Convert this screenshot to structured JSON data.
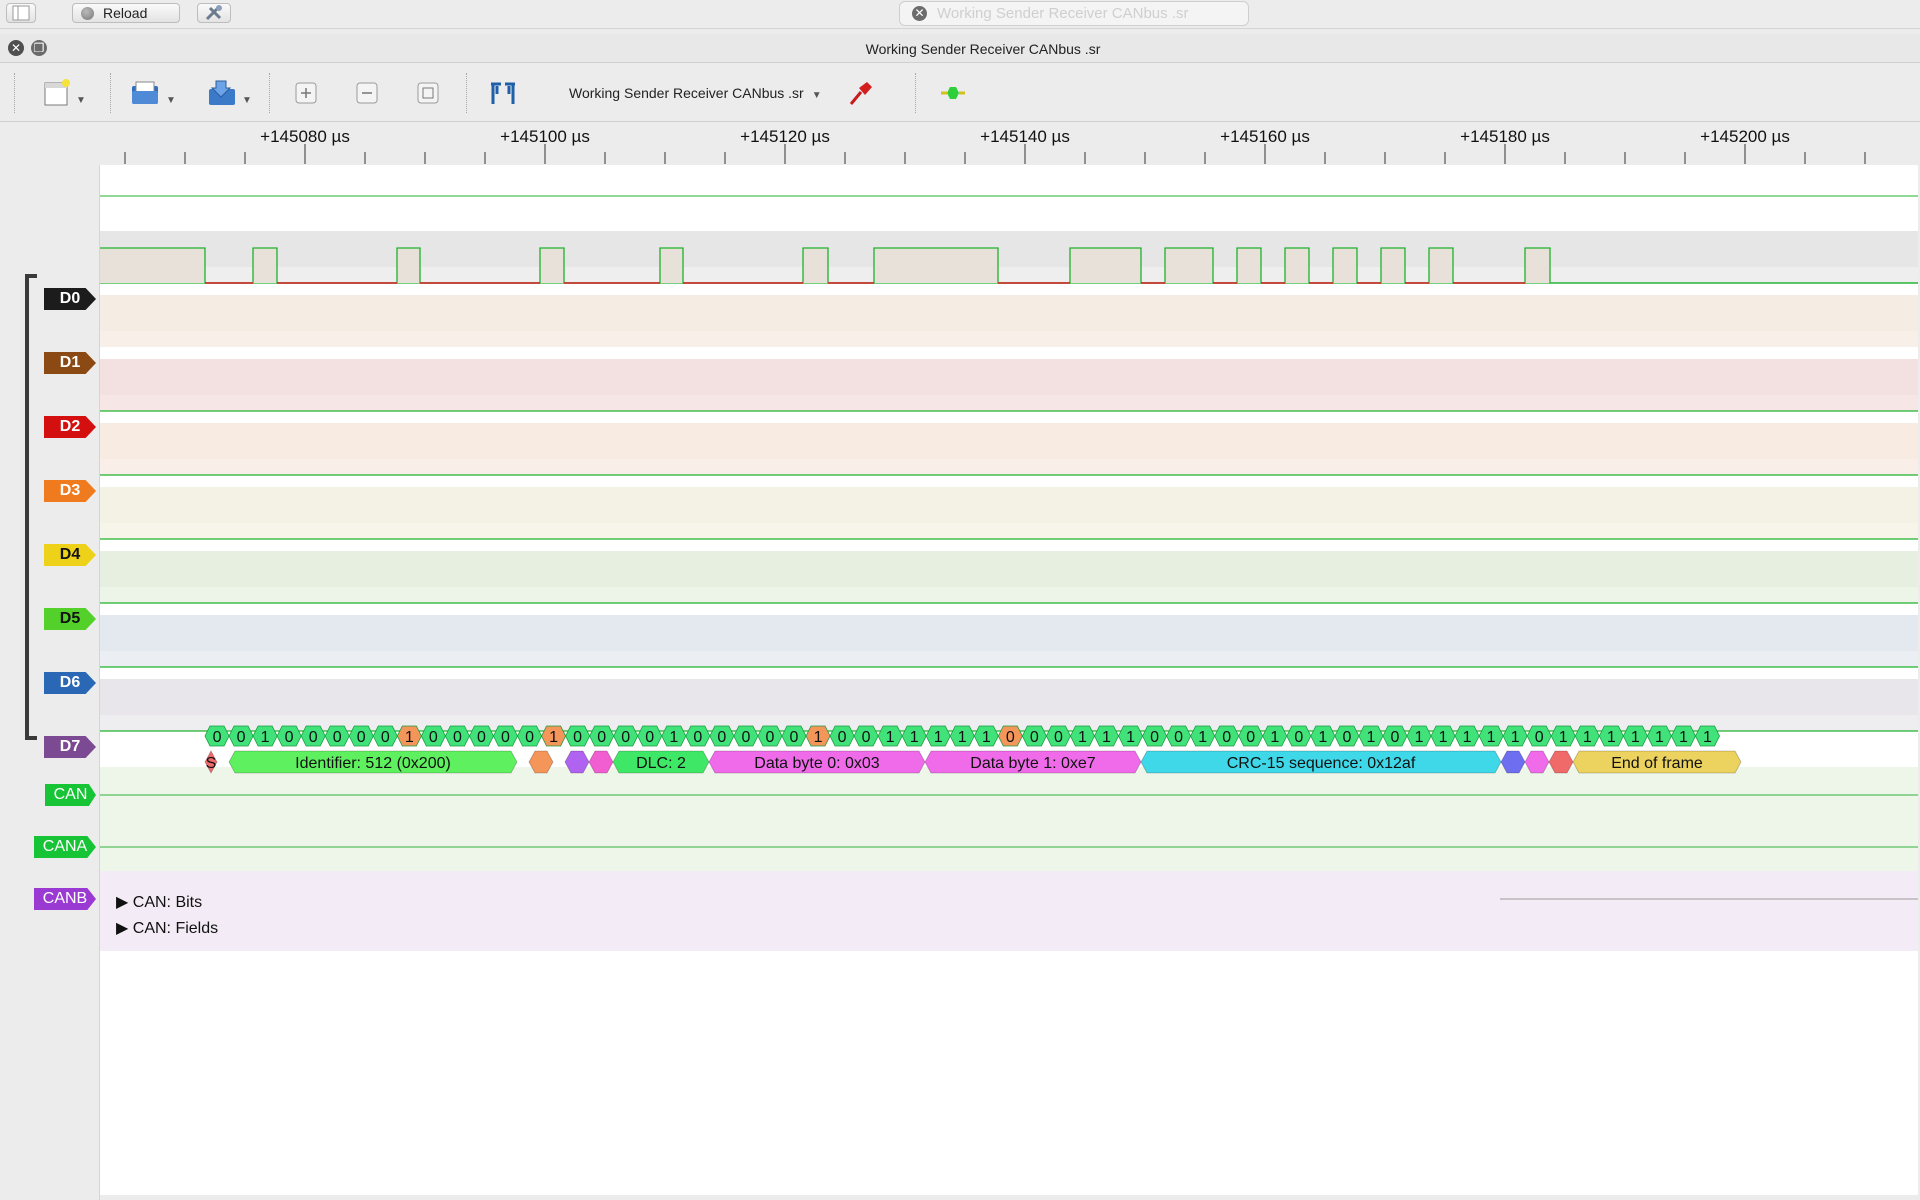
{
  "app": {
    "reload_label": "Reload",
    "tab_title": "Working Sender Receiver CANbus .sr",
    "window_title": "Working Sender Receiver CANbus .sr"
  },
  "toolbar": {
    "session_name": "Working Sender Receiver CANbus .sr",
    "items": [
      {
        "icon": "new-session-icon"
      },
      {
        "icon": "open-icon"
      },
      {
        "icon": "save-icon"
      },
      {
        "icon": "zoom-in-icon"
      },
      {
        "icon": "zoom-out-icon"
      },
      {
        "icon": "zoom-fit-icon"
      },
      {
        "icon": "cursor-icon"
      },
      {
        "icon": "probe-icon"
      },
      {
        "icon": "decoder-icon"
      }
    ]
  },
  "ruler": {
    "labels": [
      "+145080 µs",
      "+145100 µs",
      "+145120 µs",
      "+145140 µs",
      "+145160 µs",
      "+145180 µs",
      "+145200 µs"
    ]
  },
  "channels": [
    {
      "name": "D0",
      "color": "#1c1c1c"
    },
    {
      "name": "D1",
      "color": "#8b4a13"
    },
    {
      "name": "D2",
      "color": "#d40f0f"
    },
    {
      "name": "D3",
      "color": "#f07a1e"
    },
    {
      "name": "D4",
      "color": "#eed21a"
    },
    {
      "name": "D5",
      "color": "#53d12a"
    },
    {
      "name": "D6",
      "color": "#2a67b5"
    },
    {
      "name": "D7",
      "color": "#7b4a93"
    }
  ],
  "decoders": [
    {
      "name": "CAN",
      "color": "#17c435"
    },
    {
      "name": "CANA",
      "color": "#17c435"
    },
    {
      "name": "CANB",
      "color": "#9b3ad2"
    }
  ],
  "decoder_rows": {
    "bits_label": "CAN: Bits",
    "fields_label": "CAN: Fields"
  },
  "can_bits": [
    "0",
    "0",
    "1",
    "0",
    "0",
    "0",
    "0",
    "0",
    "1",
    "0",
    "0",
    "0",
    "0",
    "0",
    "1",
    "0",
    "0",
    "0",
    "0",
    "1",
    "0",
    "0",
    "0",
    "0",
    "0",
    "1",
    "0",
    "0",
    "1",
    "1",
    "1",
    "1",
    "1",
    "0",
    "0",
    "0",
    "1",
    "1",
    "1",
    "0",
    "0",
    "1",
    "0",
    "0",
    "1",
    "0",
    "1",
    "0",
    "1",
    "0",
    "1",
    "1",
    "1",
    "1",
    "1",
    "0",
    "1",
    "1",
    "1",
    "1",
    "1",
    "1",
    "1"
  ],
  "can_fields": [
    {
      "label": "S",
      "color": "#f06a6a"
    },
    {
      "label": "Identifier: 512 (0x200)",
      "color": "#5ff05f"
    },
    {
      "label": "",
      "color": "#f4955a"
    },
    {
      "label": "",
      "color": "#b062f0"
    },
    {
      "label": "",
      "color": "#f05ed2"
    },
    {
      "label": "DLC: 2",
      "color": "#3ee866"
    },
    {
      "label": "Data byte 0: 0x03",
      "color": "#f06bea"
    },
    {
      "label": "Data byte 1: 0xe7",
      "color": "#f06bea"
    },
    {
      "label": "CRC-15 sequence: 0x12af",
      "color": "#3ed8e8"
    },
    {
      "label": "",
      "color": "#6e6ef0"
    },
    {
      "label": "",
      "color": "#f06bea"
    },
    {
      "label": "",
      "color": "#f06a6a"
    },
    {
      "label": "End of frame",
      "color": "#ecd25e"
    }
  ]
}
